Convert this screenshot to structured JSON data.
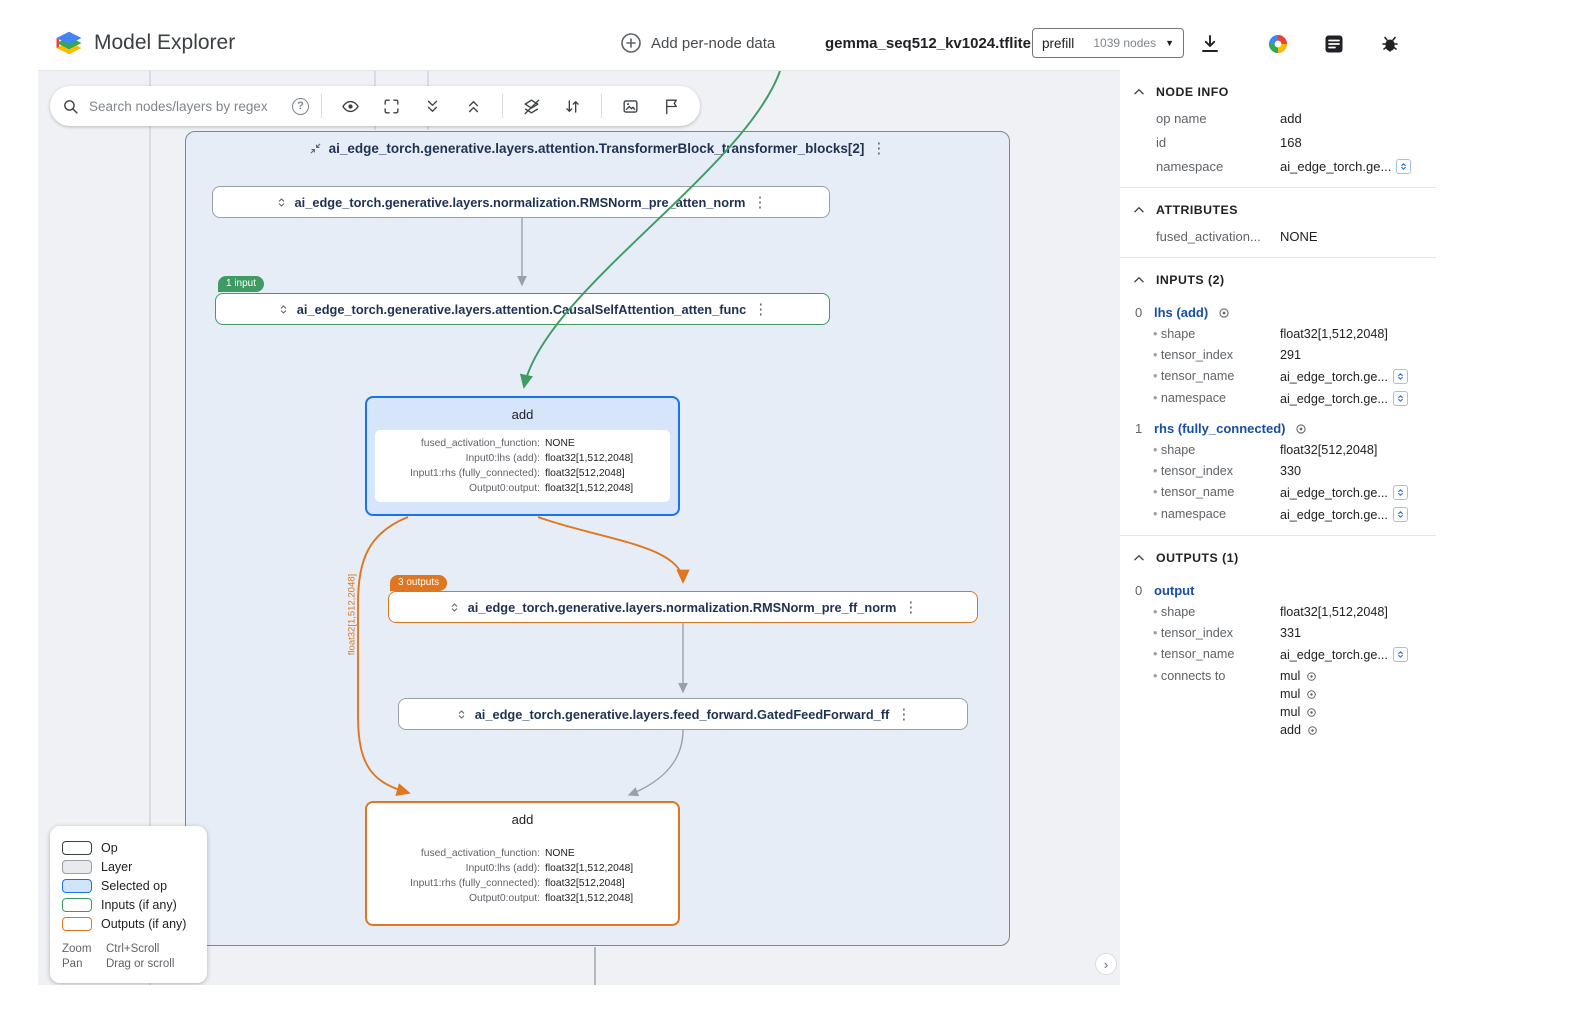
{
  "header": {
    "app_title": "Model Explorer",
    "add_per_node_data_label": "Add per-node data",
    "model_name": "gemma_seq512_kv1024.tflite",
    "graph_name": "prefill",
    "node_count": "1039 nodes"
  },
  "icons": {
    "kebab": "⋮",
    "caret_down": "▼",
    "help": "?",
    "chevron_right": "›"
  },
  "canvas": {
    "search_placeholder": "Search nodes/layers by regex",
    "container_title": "ai_edge_torch.generative.layers.attention.TransformerBlock_transformer_blocks[2]",
    "nodes": {
      "pre_atten_norm": "ai_edge_torch.generative.layers.normalization.RMSNorm_pre_atten_norm",
      "atten_func": "ai_edge_torch.generative.layers.attention.CausalSelfAttention_atten_func",
      "pre_ff_norm": "ai_edge_torch.generative.layers.normalization.RMSNorm_pre_ff_norm",
      "gated_ff": "ai_edge_torch.generative.layers.feed_forward.GatedFeedForward_ff"
    },
    "badges": {
      "input": "1 input",
      "outputs": "3 outputs"
    },
    "edge_label": "float32[1,512,2048]",
    "add_node": {
      "title": "add",
      "rows": [
        {
          "key": "fused_activation_function:",
          "value": "NONE"
        },
        {
          "key": "Input0:lhs (add):",
          "value": "float32[1,512,2048]"
        },
        {
          "key": "Input1:rhs (fully_connected):",
          "value": "float32[512,2048]"
        },
        {
          "key": "Output0:output:",
          "value": "float32[1,512,2048]"
        }
      ]
    },
    "legend": {
      "items": [
        {
          "label": "Op"
        },
        {
          "label": "Layer"
        },
        {
          "label": "Selected op"
        },
        {
          "label": "Inputs (if any)"
        },
        {
          "label": "Outputs (if any)"
        }
      ],
      "hints": [
        {
          "action": "Zoom",
          "gesture": "Ctrl+Scroll"
        },
        {
          "action": "Pan",
          "gesture": "Drag or scroll"
        }
      ]
    }
  },
  "panel": {
    "node_info": {
      "title": "NODE INFO",
      "rows": [
        {
          "key": "op name",
          "value": "add"
        },
        {
          "key": "id",
          "value": "168"
        },
        {
          "key": "namespace",
          "value": "ai_edge_torch.ge..."
        }
      ]
    },
    "attributes": {
      "title": "ATTRIBUTES",
      "rows": [
        {
          "key": "fused_activation...",
          "value": "NONE"
        }
      ]
    },
    "inputs": {
      "title": "INPUTS (2)",
      "items": [
        {
          "index": "0",
          "name": "lhs (add)",
          "rows": [
            {
              "key": "shape",
              "value": "float32[1,512,2048]"
            },
            {
              "key": "tensor_index",
              "value": "291"
            },
            {
              "key": "tensor_name",
              "value": "ai_edge_torch.ge..."
            },
            {
              "key": "namespace",
              "value": "ai_edge_torch.ge..."
            }
          ]
        },
        {
          "index": "1",
          "name": "rhs (fully_connected)",
          "rows": [
            {
              "key": "shape",
              "value": "float32[512,2048]"
            },
            {
              "key": "tensor_index",
              "value": "330"
            },
            {
              "key": "tensor_name",
              "value": "ai_edge_torch.ge..."
            },
            {
              "key": "namespace",
              "value": "ai_edge_torch.ge..."
            }
          ]
        }
      ]
    },
    "outputs": {
      "title": "OUTPUTS (1)",
      "items": [
        {
          "index": "0",
          "name": "output",
          "rows": [
            {
              "key": "shape",
              "value": "float32[1,512,2048]"
            },
            {
              "key": "tensor_index",
              "value": "331"
            },
            {
              "key": "tensor_name",
              "value": "ai_edge_torch.ge..."
            }
          ],
          "connects_key": "connects to",
          "connects_to": [
            "mul",
            "mul",
            "mul",
            "add"
          ]
        }
      ]
    }
  },
  "colors": {
    "selected_blue": "#1a73e8",
    "input_green": "#3d9b63",
    "output_orange": "#df7620"
  }
}
